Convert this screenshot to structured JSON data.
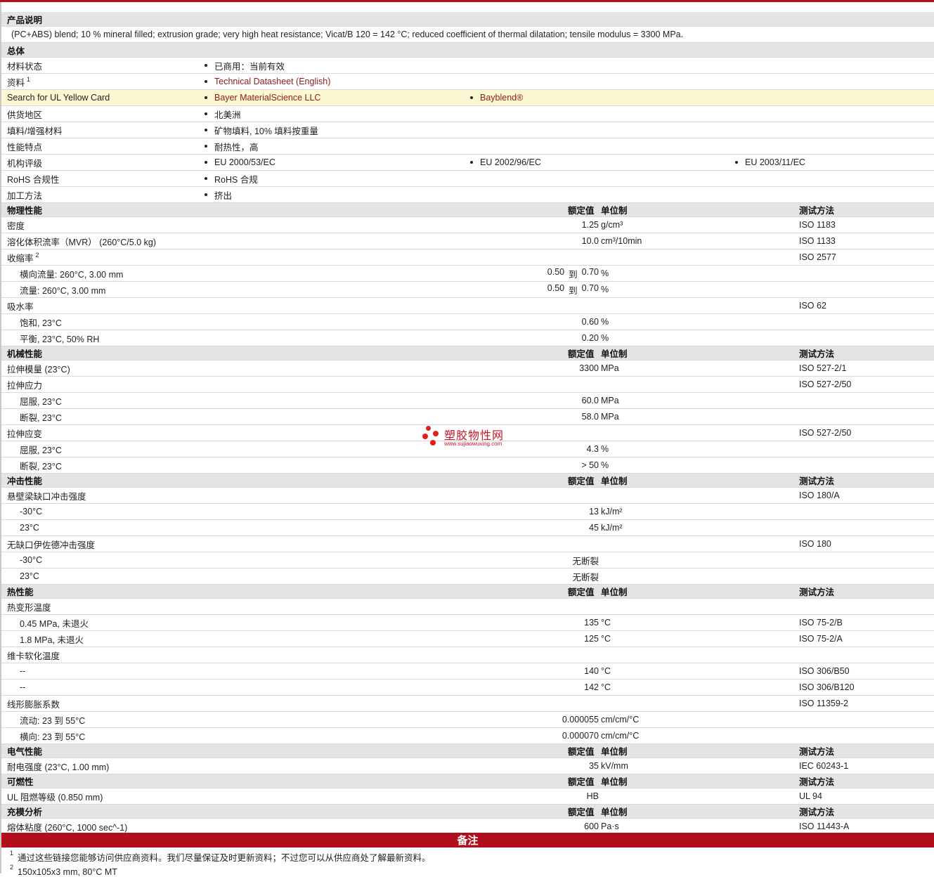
{
  "description": {
    "title": "产品说明",
    "text": "(PC+ABS) blend; 10 % mineral filled; extrusion grade; very high heat resistance; Vicat/B 120 = 142 °C; reduced coefficient of thermal dilatation; tensile modulus = 3300 MPa."
  },
  "general": {
    "title": "总体",
    "rows": [
      {
        "label": "材料状态",
        "values": [
          "已商用：当前有效"
        ]
      },
      {
        "label": "资料",
        "sup": "1",
        "values": [
          "Technical Datasheet (English)"
        ],
        "link": true
      },
      {
        "label": "Search for UL Yellow Card",
        "values": [
          "Bayer MaterialScience LLC",
          "Bayblend®"
        ],
        "link": true,
        "highlight": true
      },
      {
        "label": "供货地区",
        "values": [
          "北美洲"
        ]
      },
      {
        "label": "填料/增强材料",
        "values": [
          "矿物填料, 10% 填料按重量"
        ]
      },
      {
        "label": "性能特点",
        "values": [
          "耐热性，高"
        ]
      },
      {
        "label": "机构评级",
        "values": [
          "EU 2000/53/EC",
          "EU 2002/96/EC",
          "EU 2003/11/EC"
        ]
      },
      {
        "label": "RoHS 合规性",
        "values": [
          "RoHS 合规"
        ]
      },
      {
        "label": "加工方法",
        "values": [
          "挤出"
        ]
      }
    ]
  },
  "headers": {
    "value": "额定值",
    "unit": "单位制",
    "test": "测试方法",
    "range_word": "到"
  },
  "sections": [
    {
      "title": "物理性能",
      "rows": [
        {
          "label": "密度",
          "value": "1.25",
          "unit": "g/cm³",
          "test": "ISO 1183"
        },
        {
          "label": "溶化体积流率（MVR） (260°C/5.0 kg)",
          "value": "10.0",
          "unit": "cm³/10min",
          "test": "ISO 1133"
        },
        {
          "label": "收缩率",
          "sup": "2",
          "test": "ISO 2577"
        },
        {
          "label": "横向流量: 260°C, 3.00 mm",
          "sub": true,
          "range": [
            "0.50",
            "0.70"
          ],
          "unit": "%"
        },
        {
          "label": "流量: 260°C, 3.00 mm",
          "sub": true,
          "range": [
            "0.50",
            "0.70"
          ],
          "unit": "%"
        },
        {
          "label": "吸水率",
          "test": "ISO 62"
        },
        {
          "label": "饱和, 23°C",
          "sub": true,
          "value": "0.60",
          "unit": "%"
        },
        {
          "label": "平衡, 23°C, 50% RH",
          "sub": true,
          "value": "0.20",
          "unit": "%"
        }
      ]
    },
    {
      "title": "机械性能",
      "rows": [
        {
          "label": "拉伸模量 (23°C)",
          "value": "3300",
          "unit": "MPa",
          "test": "ISO 527-2/1"
        },
        {
          "label": "拉伸应力",
          "test": "ISO 527-2/50"
        },
        {
          "label": "屈服, 23°C",
          "sub": true,
          "value": "60.0",
          "unit": "MPa"
        },
        {
          "label": "断裂, 23°C",
          "sub": true,
          "value": "58.0",
          "unit": "MPa"
        },
        {
          "label": "拉伸应变",
          "test": "ISO 527-2/50"
        },
        {
          "label": "屈服, 23°C",
          "sub": true,
          "value": "4.3",
          "unit": "%"
        },
        {
          "label": "断裂, 23°C",
          "sub": true,
          "value": "> 50",
          "unit": "%"
        }
      ]
    },
    {
      "title": "冲击性能",
      "rows": [
        {
          "label": "悬壁梁缺口冲击强度",
          "test": "ISO 180/A"
        },
        {
          "label": "-30°C",
          "sub": true,
          "value": "13",
          "unit": "kJ/m²"
        },
        {
          "label": "23°C",
          "sub": true,
          "value": "45",
          "unit": "kJ/m²"
        },
        {
          "label": "无缺口伊佐德冲击强度",
          "test": "ISO 180"
        },
        {
          "label": "-30°C",
          "sub": true,
          "value": "无断裂"
        },
        {
          "label": "23°C",
          "sub": true,
          "value": "无断裂"
        }
      ]
    },
    {
      "title": "热性能",
      "rows": [
        {
          "label": "热变形温度"
        },
        {
          "label": "0.45 MPa, 未退火",
          "sub": true,
          "value": "135",
          "unit": "°C",
          "test": "ISO 75-2/B"
        },
        {
          "label": "1.8 MPa, 未退火",
          "sub": true,
          "value": "125",
          "unit": "°C",
          "test": "ISO 75-2/A"
        },
        {
          "label": "维卡软化温度"
        },
        {
          "label": "--",
          "sub": true,
          "value": "140",
          "unit": "°C",
          "test": "ISO 306/B50"
        },
        {
          "label": "--",
          "sub": true,
          "value": "142",
          "unit": "°C",
          "test": "ISO 306/B120"
        },
        {
          "label": "线形膨胀系数",
          "test": "ISO 11359-2"
        },
        {
          "label": "流动: 23 到 55°C",
          "sub": true,
          "value": "0.000055",
          "unit": "cm/cm/°C"
        },
        {
          "label": "横向: 23 到 55°C",
          "sub": true,
          "value": "0.000070",
          "unit": "cm/cm/°C"
        }
      ]
    },
    {
      "title": "电气性能",
      "rows": [
        {
          "label": "耐电强度 (23°C, 1.00 mm)",
          "value": "35",
          "unit": "kV/mm",
          "test": "IEC 60243-1"
        }
      ]
    },
    {
      "title": "可燃性",
      "rows": [
        {
          "label": "UL 阻燃等级 (0.850 mm)",
          "value": "HB",
          "test": "UL 94"
        }
      ]
    },
    {
      "title": "充模分析",
      "rows": [
        {
          "label": "熔体粘度 (260°C, 1000 sec^-1)",
          "value": "600",
          "unit": "Pa·s",
          "test": "ISO 11443-A"
        }
      ]
    }
  ],
  "notes": {
    "title": "备注",
    "items": [
      {
        "sup": "1",
        "text": "通过这些链接您能够访问供应商资料。我们尽量保证及时更新资料；不过您可以从供应商处了解最新资料。"
      },
      {
        "sup": "2",
        "text": "150x105x3 mm, 80°C MT"
      }
    ]
  },
  "watermark": {
    "text": "塑胶物性网",
    "url": "www.sujiaowuxing.com"
  }
}
